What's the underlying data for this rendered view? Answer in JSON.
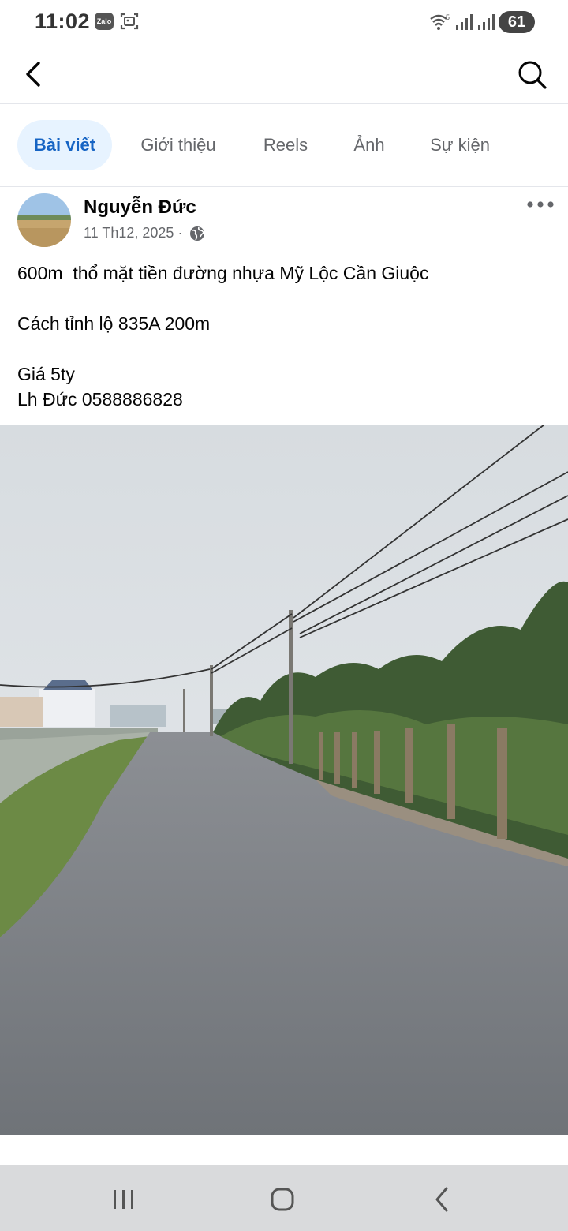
{
  "status_bar": {
    "time": "11:02",
    "zalo_label": "Zalo",
    "battery": "61",
    "wifi_badge": "5"
  },
  "tabs": [
    {
      "label": "Bài viết",
      "active": true
    },
    {
      "label": "Giới thiệu",
      "active": false
    },
    {
      "label": "Reels",
      "active": false
    },
    {
      "label": "Ảnh",
      "active": false
    },
    {
      "label": "Sự kiện",
      "active": false
    }
  ],
  "post": {
    "author": "Nguyễn Đức",
    "date": "11 Th12, 2025",
    "separator": "·",
    "privacy_icon": "globe-icon",
    "lines": [
      "600m  thổ mặt tiền đường nhựa Mỹ Lộc Cần Giuộc",
      "Cách tỉnh lộ 835A 200m",
      "Giá 5ty",
      "Lh Đức 0588886828"
    ]
  },
  "colors": {
    "accent": "#1664c4",
    "tab_active_bg": "#e7f3ff",
    "muted_text": "#65676b",
    "nav_bg": "#d9dadc"
  },
  "icons": {
    "back": "chevron-left-icon",
    "search": "search-icon",
    "more": "more-horizontal-icon",
    "nav_recent": "recent-apps-icon",
    "nav_home": "home-icon",
    "nav_back": "nav-back-icon"
  }
}
